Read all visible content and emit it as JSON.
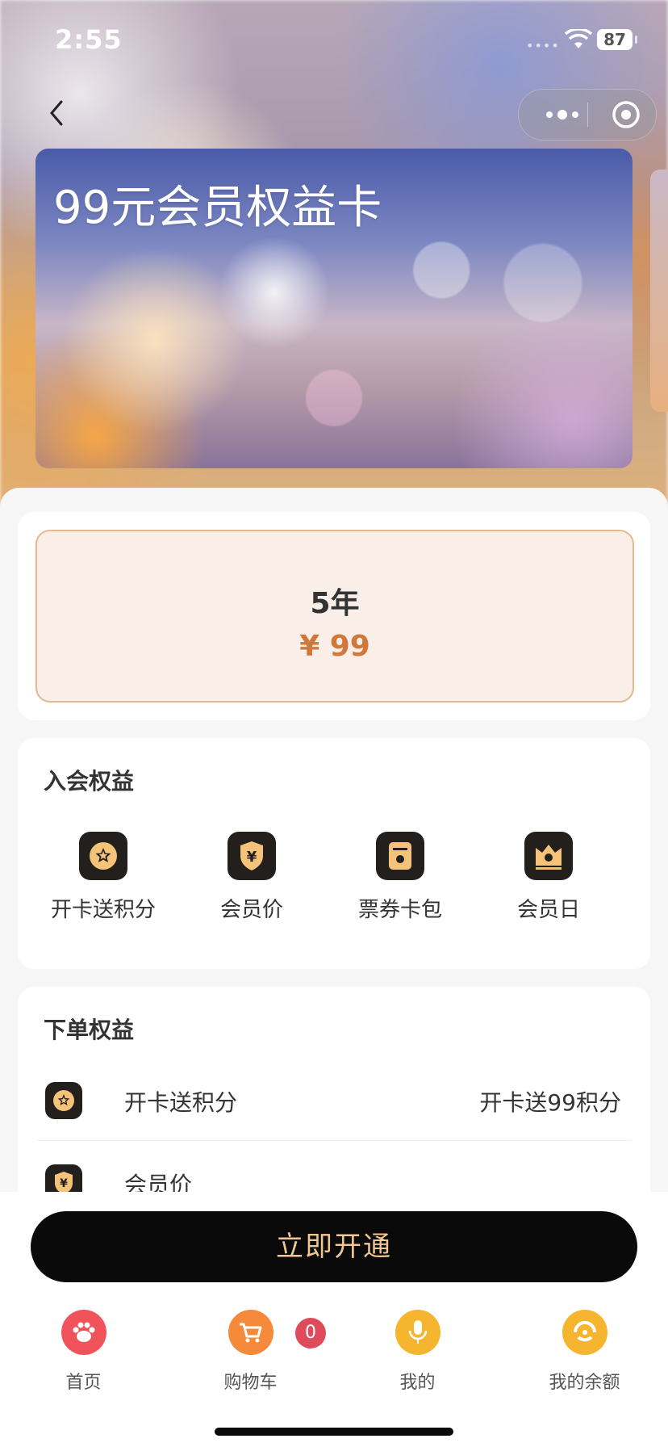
{
  "status_bar": {
    "time": "2:55",
    "battery": "87"
  },
  "header": {
    "back_icon": "chevron-left-icon",
    "more_icon": "more-dots-icon",
    "close_icon": "target-icon"
  },
  "card": {
    "title": "99元会员权益卡"
  },
  "price_option": {
    "duration": "5年",
    "price": "¥ 99"
  },
  "join_benefits": {
    "title": "入会权益",
    "items": [
      {
        "label": "开卡送积分",
        "icon": "star-points-icon"
      },
      {
        "label": "会员价",
        "icon": "yen-shield-icon"
      },
      {
        "label": "票券卡包",
        "icon": "coupon-icon"
      },
      {
        "label": "会员日",
        "icon": "crown-calendar-icon"
      }
    ]
  },
  "order_benefits": {
    "title": "下单权益",
    "rows": [
      {
        "label": "开卡送积分",
        "value": "开卡送99积分",
        "icon": "star-points-icon"
      },
      {
        "label": "会员价",
        "value": "",
        "icon": "yen-shield-icon"
      }
    ]
  },
  "action": {
    "open_label": "立即开通"
  },
  "tab_bar": {
    "tabs": [
      {
        "label": "首页",
        "icon": "paw-icon",
        "color": "#f0545a"
      },
      {
        "label": "购物车",
        "icon": "cart-icon",
        "color": "#f58a3a"
      },
      {
        "label": "我的",
        "icon": "mic-icon",
        "color": "#f5b52f"
      },
      {
        "label": "我的余额",
        "icon": "wallet-icon",
        "color": "#f5b52f"
      }
    ],
    "cart_badge": "0"
  },
  "colors": {
    "accent": "#d0773a",
    "button_bg": "#0a0a0a",
    "button_text": "#f0c793"
  }
}
